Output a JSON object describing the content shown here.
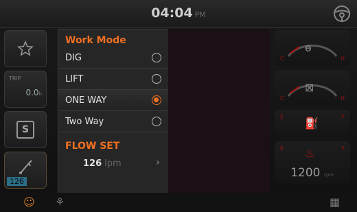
{
  "status": {
    "time": "04:04",
    "ampm": "PM"
  },
  "left_buttons": {
    "trip_label": "TRIP",
    "trip_value": "0.0",
    "trip_unit": "h",
    "s_label": "S",
    "aux_value": "126"
  },
  "work_mode": {
    "title": "Work Mode",
    "options": [
      {
        "label": "DIG",
        "selected": false
      },
      {
        "label": "LIFT",
        "selected": false
      },
      {
        "label": "ONE WAY",
        "selected": true
      },
      {
        "label": "Two Way",
        "selected": false
      }
    ]
  },
  "flow_set": {
    "title": "FLOW SET",
    "value": "126",
    "unit": "lpm"
  },
  "gauges": {
    "e_label": "E",
    "f_label": "F",
    "h_label": "H",
    "c_label": "C",
    "rpm_value": "1200",
    "rpm_unit": "rpm"
  },
  "colors": {
    "accent": "#f07021",
    "warn": "#a01010",
    "panel": "#262626"
  },
  "icons": [
    "steering-wheel-icon",
    "star-icon",
    "aux-hydraulic-icon",
    "engine-icon",
    "coolant-icon",
    "fuel-icon",
    "rpm-icon",
    "person-icon",
    "camera-icon",
    "wrench-icon"
  ]
}
